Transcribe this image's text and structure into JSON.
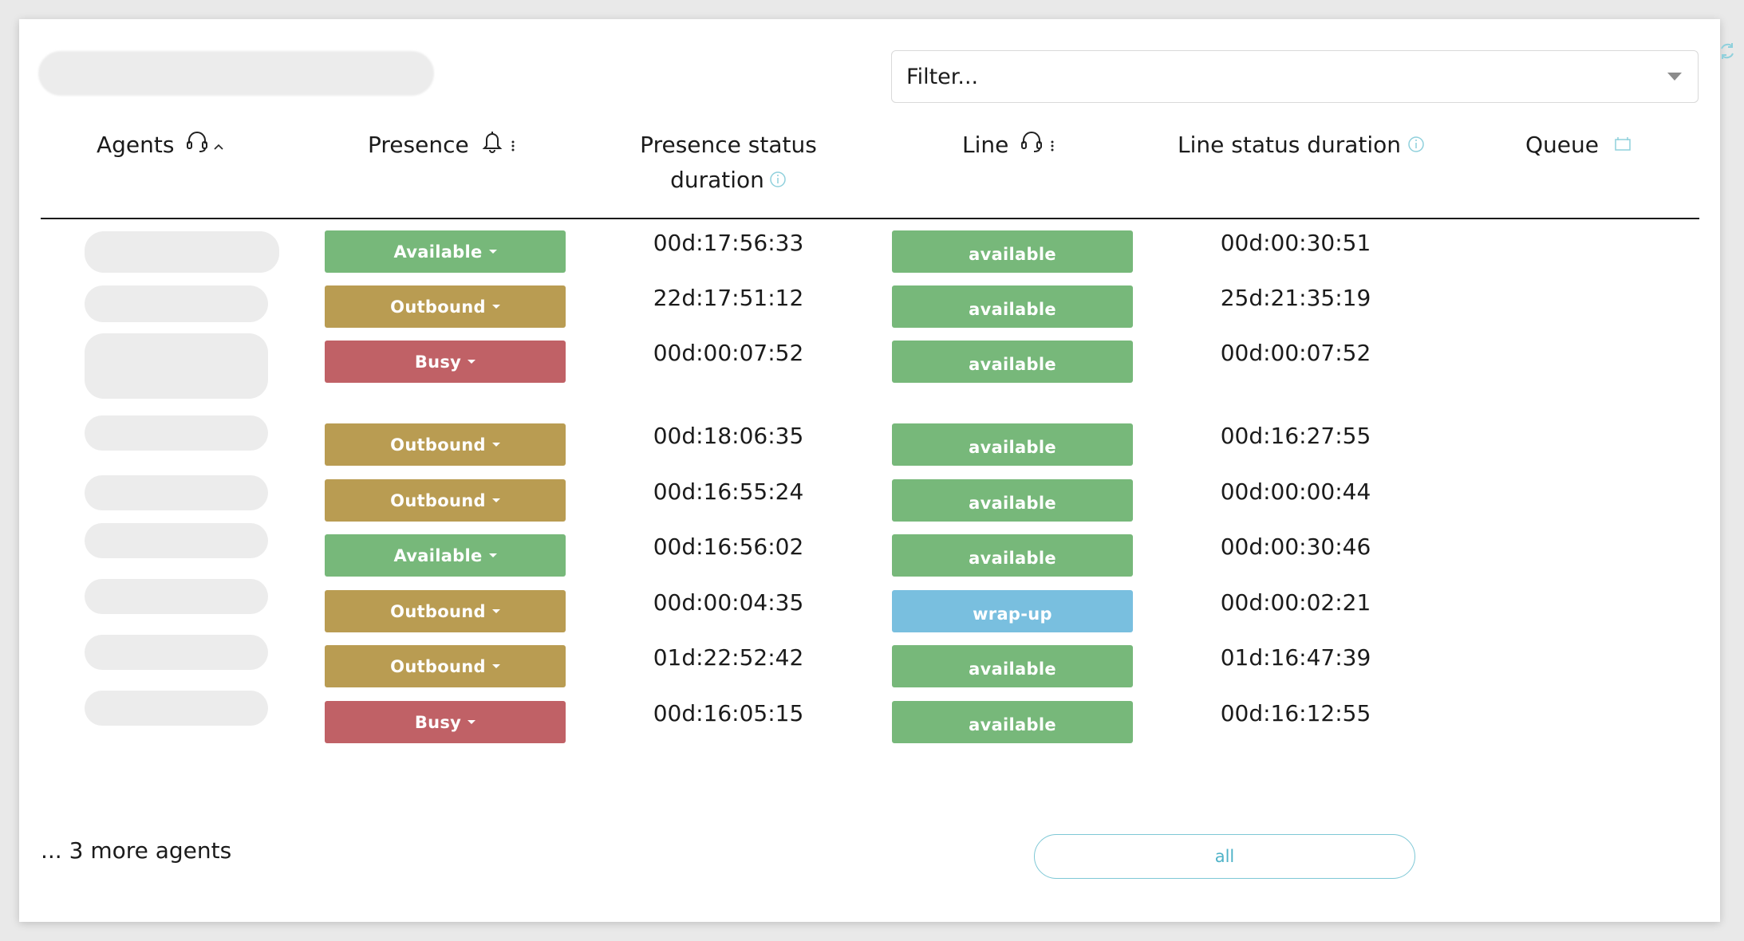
{
  "filter": {
    "placeholder": "Filter..."
  },
  "columns": {
    "agents": "Agents",
    "presence": "Presence",
    "presence_duration_line1": "Presence status",
    "presence_duration_line2": "duration",
    "line": "Line",
    "line_duration": "Line status duration",
    "queue": "Queue"
  },
  "rows": [
    {
      "presence": "Available",
      "presence_status": "available-green",
      "presence_duration": "00d:17:56:33",
      "line": "available",
      "line_status": "available-green",
      "line_duration": "00d:00:30:51"
    },
    {
      "presence": "Outbound",
      "presence_status": "outbound-gold",
      "presence_duration": "22d:17:51:12",
      "line": "available",
      "line_status": "available-green",
      "line_duration": "25d:21:35:19"
    },
    {
      "presence": "Busy",
      "presence_status": "busy-red",
      "presence_duration": "00d:00:07:52",
      "line": "available",
      "line_status": "available-green",
      "line_duration": "00d:00:07:52"
    },
    {
      "presence": "Outbound",
      "presence_status": "outbound-gold",
      "presence_duration": "00d:18:06:35",
      "line": "available",
      "line_status": "available-green",
      "line_duration": "00d:16:27:55"
    },
    {
      "presence": "Outbound",
      "presence_status": "outbound-gold",
      "presence_duration": "00d:16:55:24",
      "line": "available",
      "line_status": "available-green",
      "line_duration": "00d:00:00:44"
    },
    {
      "presence": "Available",
      "presence_status": "available-green",
      "presence_duration": "00d:16:56:02",
      "line": "available",
      "line_status": "available-green",
      "line_duration": "00d:00:30:46"
    },
    {
      "presence": "Outbound",
      "presence_status": "outbound-gold",
      "presence_duration": "00d:00:04:35",
      "line": "wrap-up",
      "line_status": "wrapup-blue",
      "line_duration": "00d:00:02:21"
    },
    {
      "presence": "Outbound",
      "presence_status": "outbound-gold",
      "presence_duration": "01d:22:52:42",
      "line": "available",
      "line_status": "available-green",
      "line_duration": "01d:16:47:39"
    },
    {
      "presence": "Busy",
      "presence_status": "busy-red",
      "presence_duration": "00d:16:05:15",
      "line": "available",
      "line_status": "available-green",
      "line_duration": "00d:16:12:55"
    }
  ],
  "colors": {
    "available-green": "#77b87a",
    "outbound-gold": "#b99c52",
    "busy-red": "#c06166",
    "wrapup-blue": "#79bfdf",
    "accent": "#4fb3c8"
  },
  "icons": {
    "agents": "headset-icon",
    "sort": "chevron-up-icon",
    "presence": "bell-icon",
    "presence_menu": "kebab-icon",
    "line": "headset-icon",
    "line_menu": "kebab-icon",
    "info": "info-icon",
    "queue": "queue-icon",
    "refresh": "refresh-icon"
  },
  "footer": {
    "more_agents": "... 3 more agents",
    "all_button": "all"
  }
}
